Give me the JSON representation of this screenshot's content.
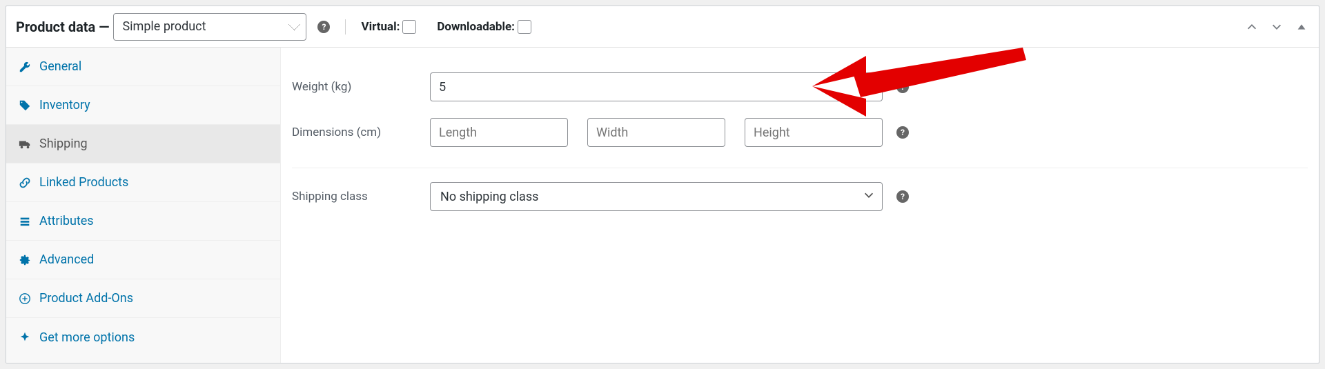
{
  "header": {
    "title": "Product data —",
    "product_type_selected": "Simple product",
    "virtual_label": "Virtual:",
    "downloadable_label": "Downloadable:",
    "virtual_checked": false,
    "downloadable_checked": false
  },
  "sidebar": {
    "items": [
      {
        "icon": "wrench-icon",
        "label": "General"
      },
      {
        "icon": "tag-icon",
        "label": "Inventory"
      },
      {
        "icon": "truck-icon",
        "label": "Shipping",
        "active": true
      },
      {
        "icon": "link-icon",
        "label": "Linked Products"
      },
      {
        "icon": "list-icon",
        "label": "Attributes"
      },
      {
        "icon": "gear-icon",
        "label": "Advanced"
      },
      {
        "icon": "plus-icon",
        "label": "Product Add-Ons"
      },
      {
        "icon": "bell-icon",
        "label": "Get more options"
      }
    ]
  },
  "shipping": {
    "weight_label": "Weight (kg)",
    "weight_value": "5",
    "dimensions_label": "Dimensions (cm)",
    "length_placeholder": "Length",
    "width_placeholder": "Width",
    "height_placeholder": "Height",
    "shipping_class_label": "Shipping class",
    "shipping_class_selected": "No shipping class"
  },
  "annotation": {
    "color": "#e30000"
  }
}
